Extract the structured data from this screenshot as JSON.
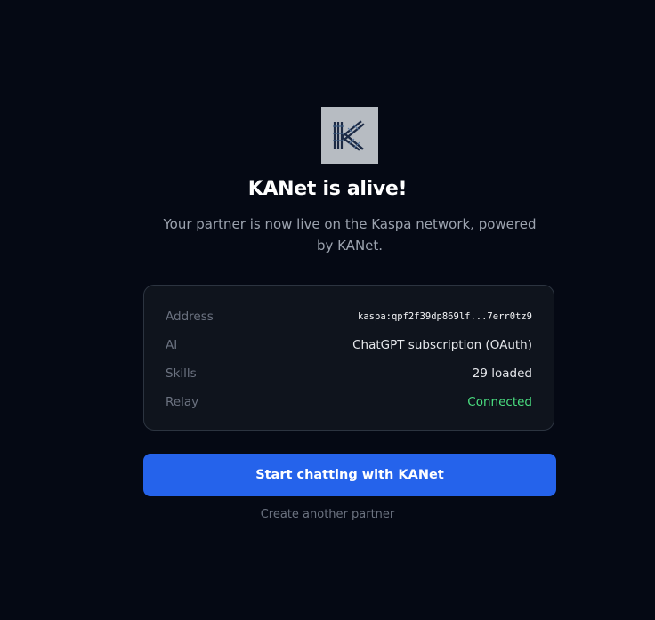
{
  "header": {
    "logo_icon": "kanet-k-logo",
    "title": "KANet is alive!",
    "subtitle": "Your partner is now live on the Kaspa network, powered by KANet."
  },
  "details": {
    "address_label": "Address",
    "address_value": "kaspa:qpf2f39dp869lf...7err0tz9",
    "ai_label": "AI",
    "ai_value": "ChatGPT subscription (OAuth)",
    "skills_label": "Skills",
    "skills_value": "29 loaded",
    "relay_label": "Relay",
    "relay_value": "Connected"
  },
  "actions": {
    "primary_label": "Start chatting with KANet",
    "secondary_label": "Create another partner"
  },
  "colors": {
    "background": "#050914",
    "card": "#0f141d",
    "accent": "#2563eb",
    "status_ok": "#4ade80"
  }
}
